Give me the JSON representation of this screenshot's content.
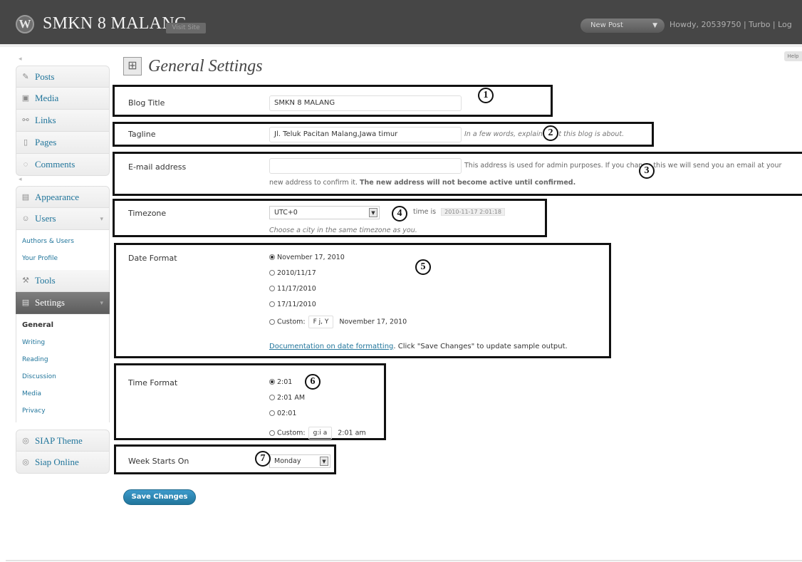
{
  "header": {
    "site_title": "SMKN 8 MALANG",
    "visit_site": "Visit Site",
    "new_post": "New Post",
    "howdy": "Howdy, 20539750 | Turbo | Log"
  },
  "sidebar": {
    "top_items": [
      "Posts",
      "Media",
      "Links",
      "Pages",
      "Comments"
    ],
    "appearance": "Appearance",
    "users": "Users",
    "users_sub": [
      "Authors & Users",
      "Your Profile"
    ],
    "tools": "Tools",
    "settings": "Settings",
    "settings_sub": [
      "General",
      "Writing",
      "Reading",
      "Discussion",
      "Media",
      "Privacy"
    ],
    "bottom_items": [
      "SIAP Theme",
      "Siap Online"
    ]
  },
  "page": {
    "title": "General Settings",
    "help": "Help"
  },
  "form": {
    "blog_title_label": "Blog Title",
    "blog_title_value": "SMKN 8 MALANG",
    "tagline_label": "Tagline",
    "tagline_value": "Jl. Teluk Pacitan Malang,Jawa timur",
    "tagline_hint": "In a few words, explain what this blog is about.",
    "email_label": "E-mail address",
    "email_value": "",
    "email_hint": "This address is used for admin purposes. If you change this we will send you an email at your",
    "email_hint2_pre": "new address to confirm it.",
    "email_hint2_bold": "The new address will not become active until confirmed.",
    "timezone_label": "Timezone",
    "timezone_value": "UTC+0",
    "utc_time_label": "time is",
    "utc_time_value": "2010-11-17 2:01:18",
    "timezone_hint": "Choose a city in the same timezone as you.",
    "date_format_label": "Date Format",
    "date_options": [
      "November 17, 2010",
      "2010/11/17",
      "11/17/2010",
      "17/11/2010"
    ],
    "custom_label": "Custom:",
    "date_custom_value": "F j, Y",
    "date_custom_preview": "November 17, 2010",
    "date_doc_link": "Documentation on date formatting",
    "date_doc_tail": ". Click \"Save Changes\" to update sample output.",
    "time_format_label": "Time Format",
    "time_options": [
      "2:01",
      "2:01 AM",
      "02:01"
    ],
    "time_custom_value": "g:i a",
    "time_custom_preview": "2:01 am",
    "week_label": "Week Starts On",
    "week_value": "Monday",
    "save_button": "Save Changes"
  },
  "annotations": [
    "1",
    "2",
    "3",
    "4",
    "5",
    "6",
    "7"
  ]
}
